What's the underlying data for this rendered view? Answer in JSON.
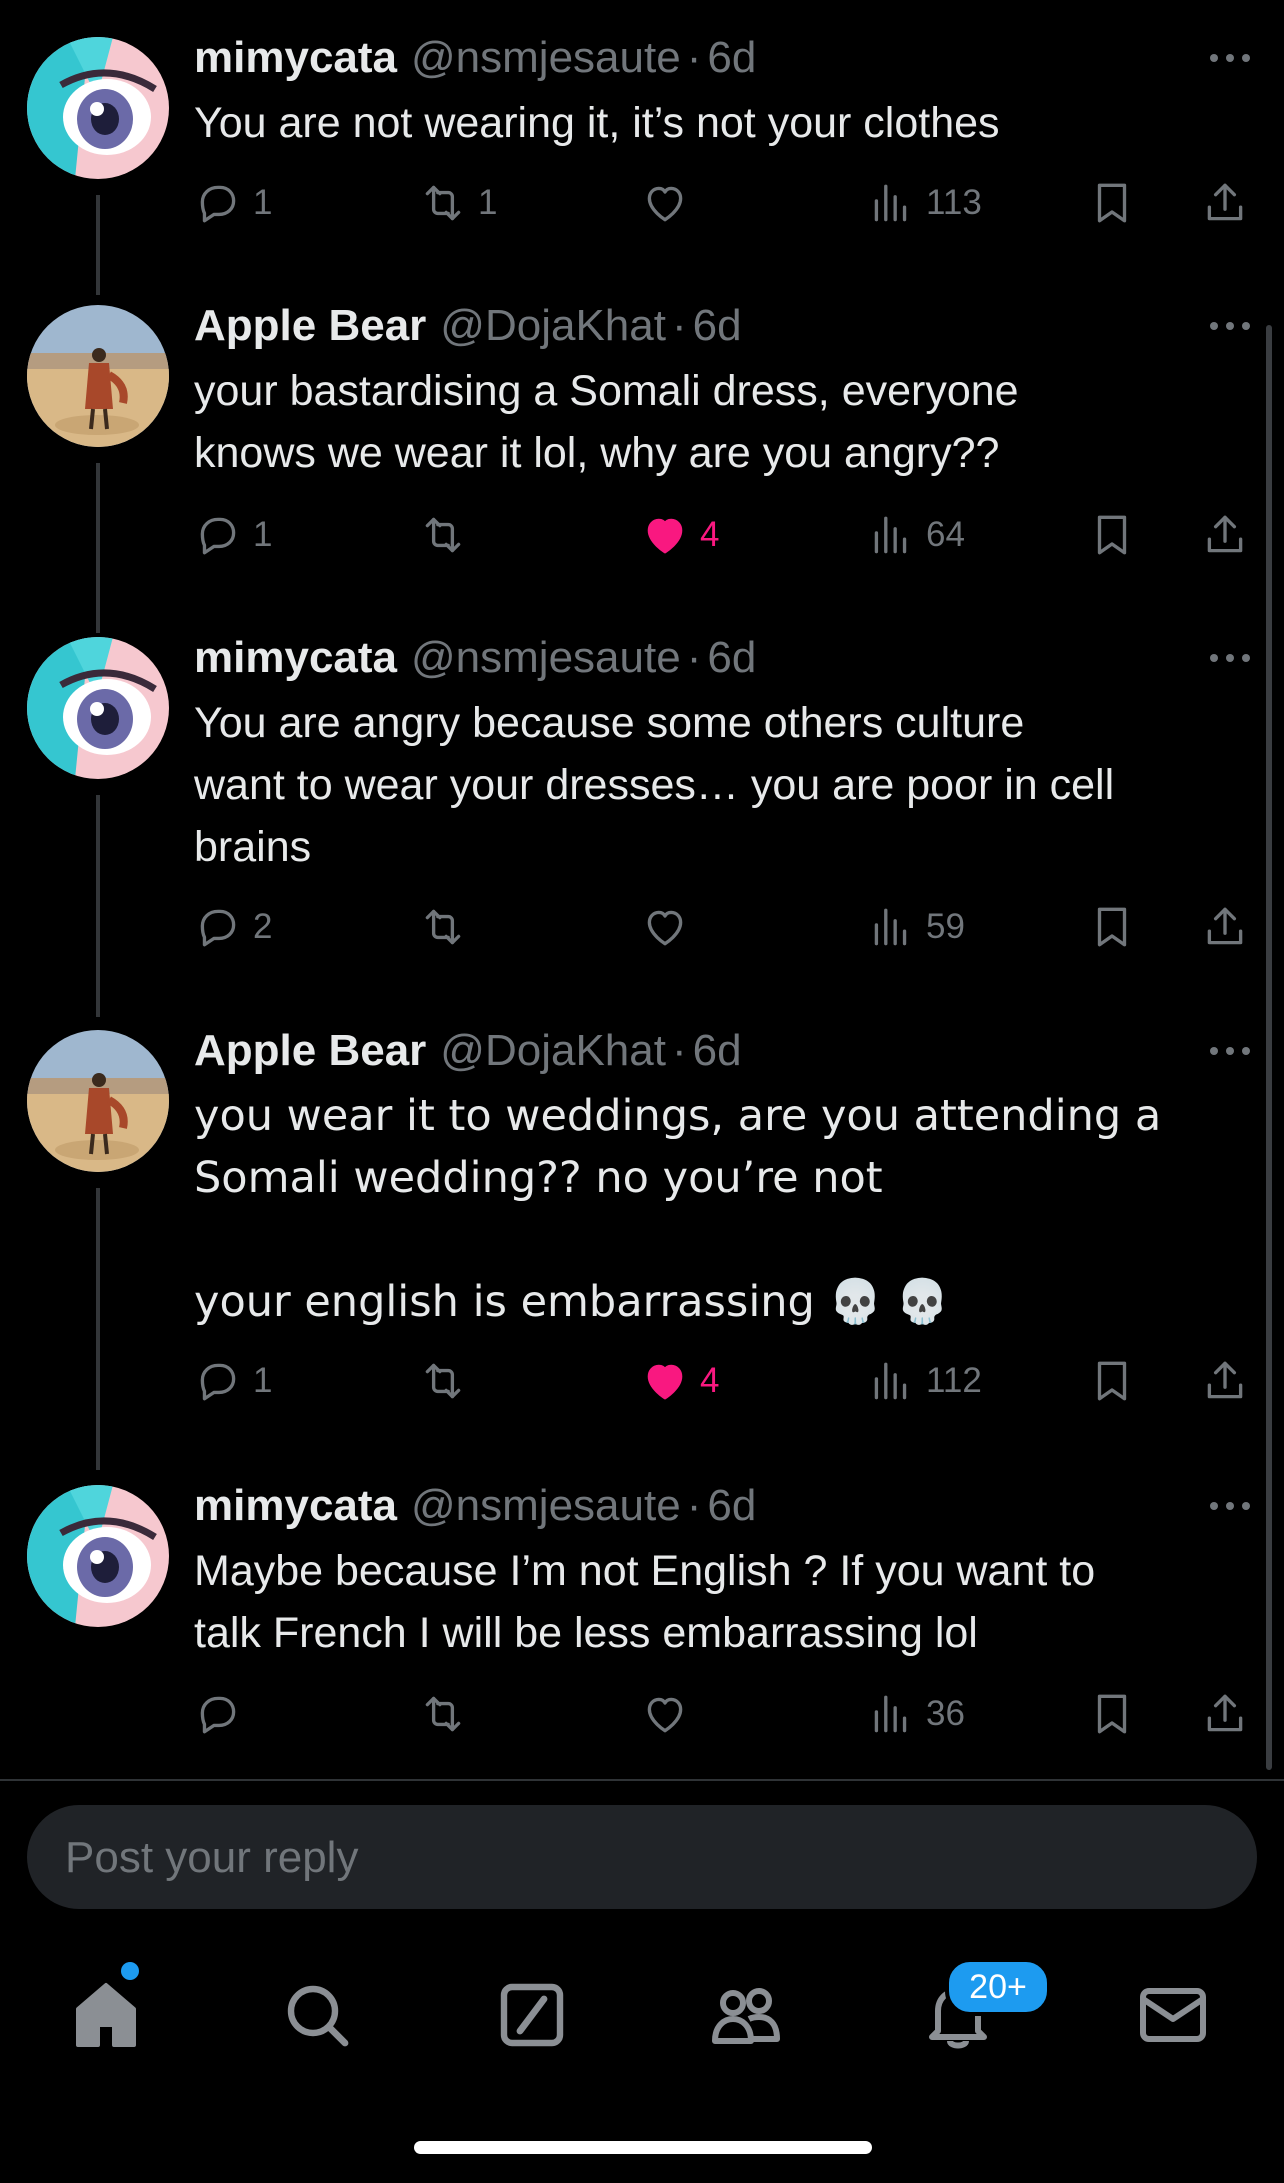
{
  "tweets": [
    {
      "name": "mimycata",
      "handle": "@nsmjesaute",
      "time": "6d",
      "text": "You are not wearing it, it’s not your clothes",
      "avatar": "anime-eye-avatar",
      "replies": "1",
      "retweets": "1",
      "likes": "",
      "liked": false,
      "views": "113"
    },
    {
      "name": "Apple Bear",
      "handle": "@DojaKhat",
      "time": "6d",
      "text": "your bastardising a Somali dress, everyone\nknows we wear it lol, why are you angry??",
      "avatar": "desert-person-avatar",
      "replies": "1",
      "retweets": "",
      "likes": "4",
      "liked": true,
      "views": "64"
    },
    {
      "name": "mimycata",
      "handle": "@nsmjesaute",
      "time": "6d",
      "text": "You are angry because some others culture\nwant to wear your dresses… you are poor in cell\nbrains",
      "avatar": "anime-eye-avatar",
      "replies": "2",
      "retweets": "",
      "likes": "",
      "liked": false,
      "views": "59"
    },
    {
      "name": "Apple Bear",
      "handle": "@DojaKhat",
      "time": "6d",
      "text": "you wear it to weddings, are you attending a\nSomali wedding?? no you’re not\n\nyour english is embarrassing 💀 💀",
      "avatar": "desert-person-avatar",
      "replies": "1",
      "retweets": "",
      "likes": "4",
      "liked": true,
      "views": "112"
    },
    {
      "name": "mimycata",
      "handle": "@nsmjesaute",
      "time": "6d",
      "text": "Maybe because I’m not English ? If you want to\ntalk French I will be less embarrassing lol",
      "avatar": "anime-eye-avatar",
      "replies": "",
      "retweets": "",
      "likes": "",
      "liked": false,
      "views": "36"
    }
  ],
  "dot_separator": "·",
  "reply_box": {
    "placeholder": "Post your reply"
  },
  "bottom_nav": {
    "items": [
      "home-icon",
      "search-icon",
      "grok-icon",
      "communities-icon",
      "notifications-icon",
      "messages-icon"
    ],
    "notifications_badge": "20+"
  },
  "colors": {
    "like": "#f91880",
    "accent": "#1d9bf0",
    "muted": "#71767b",
    "text": "#e7e9ea",
    "background": "#000000"
  }
}
